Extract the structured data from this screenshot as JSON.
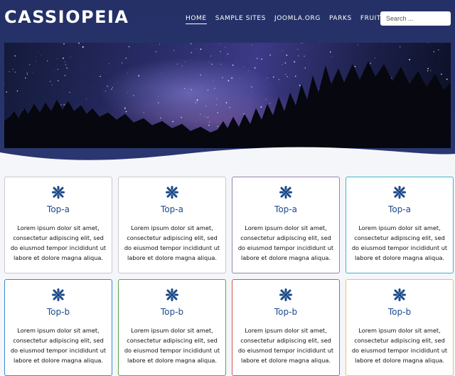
{
  "header": {
    "brand": "CASSIOPEIA",
    "nav": [
      "HOME",
      "SAMPLE SITES",
      "JOOMLA.ORG",
      "PARKS",
      "FRUIT SHOP"
    ],
    "active_nav": "HOME",
    "search_placeholder": "Search ..."
  },
  "colors": {
    "header_bg": "#27346c",
    "card_title": "#1c4a8a",
    "row1_borders": [
      "#c9c9c9",
      "#c9c9c9",
      "#9a82b0",
      "#3fb7c4"
    ],
    "row2_borders": [
      "#3b86c9",
      "#62a24f",
      "#d9534f",
      "#f0c060"
    ]
  },
  "cards": [
    {
      "title": "Top-a",
      "text": "Lorem ipsum dolor sit amet, consectetur adipiscing elit, sed do eiusmod tempor incididunt ut labore et dolore magna aliqua.",
      "icon": "joomla-icon"
    },
    {
      "title": "Top-a",
      "text": "Lorem ipsum dolor sit amet, consectetur adipiscing elit, sed do eiusmod tempor incididunt ut labore et dolore magna aliqua.",
      "icon": "joomla-icon"
    },
    {
      "title": "Top-a",
      "text": "Lorem ipsum dolor sit amet, consectetur adipiscing elit, sed do eiusmod tempor incididunt ut labore et dolore magna aliqua.",
      "icon": "joomla-icon"
    },
    {
      "title": "Top-a",
      "text": "Lorem ipsum dolor sit amet, consectetur adipiscing elit, sed do eiusmod tempor incididunt ut labore et dolore magna aliqua.",
      "icon": "joomla-icon"
    },
    {
      "title": "Top-b",
      "text": "Lorem ipsum dolor sit amet, consectetur adipiscing elit, sed do eiusmod tempor incididunt ut labore et dolore magna aliqua.",
      "icon": "joomla-icon"
    },
    {
      "title": "Top-b",
      "text": "Lorem ipsum dolor sit amet, consectetur adipiscing elit, sed do eiusmod tempor incididunt ut labore et dolore magna aliqua.",
      "icon": "joomla-icon"
    },
    {
      "title": "Top-b",
      "text": "Lorem ipsum dolor sit amet, consectetur adipiscing elit, sed do eiusmod tempor incididunt ut labore et dolore magna aliqua.",
      "icon": "joomla-icon"
    },
    {
      "title": "Top-b",
      "text": "Lorem ipsum dolor sit amet, consectetur adipiscing elit, sed do eiusmod tempor incididunt ut labore et dolore magna aliqua.",
      "icon": "joomla-icon"
    }
  ]
}
